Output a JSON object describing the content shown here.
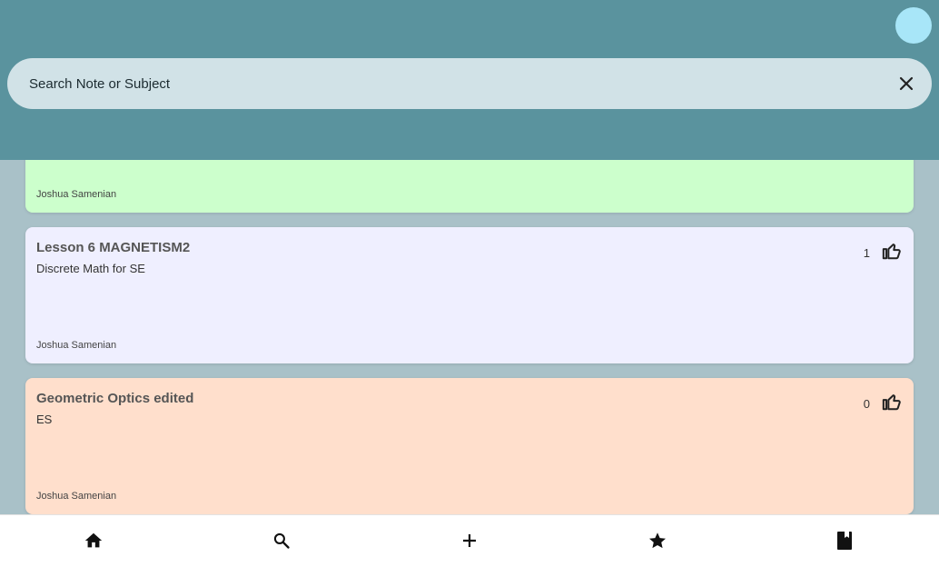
{
  "search": {
    "placeholder": "Search Note or Subject"
  },
  "notes": [
    {
      "title": "",
      "subject": "",
      "author": "Joshua Samenian",
      "likes": "",
      "color": "#ccffcc"
    },
    {
      "title": "Lesson 6 MAGNETISM2",
      "subject": "Discrete Math for SE",
      "author": "Joshua Samenian",
      "likes": "1",
      "color": "#efefff"
    },
    {
      "title": "Geometric Optics edited",
      "subject": "ES",
      "author": "Joshua Samenian",
      "likes": "0",
      "color": "#ffdfcc"
    }
  ],
  "nav": {
    "items": [
      {
        "icon": "home-icon"
      },
      {
        "icon": "search-icon"
      },
      {
        "icon": "add-icon"
      },
      {
        "icon": "star-icon"
      },
      {
        "icon": "book-icon"
      }
    ]
  },
  "colors": {
    "app_bar": "#5a939e",
    "search_bar": "#d1e2e7",
    "avatar": "#a8e6f8",
    "background": "#a9c1c8"
  }
}
